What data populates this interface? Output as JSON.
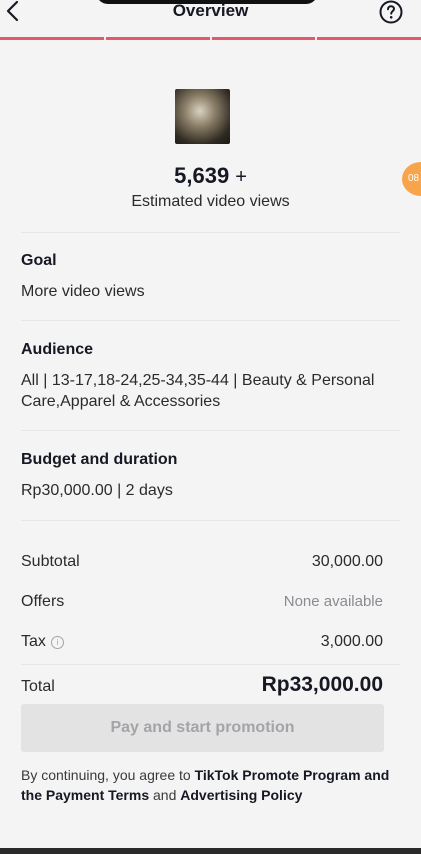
{
  "header": {
    "title": "Overview",
    "back_icon": "chevron-left-icon",
    "help_icon": "question-circle-icon",
    "accent_color": "#e8566b"
  },
  "preview": {
    "views_number": "5,639",
    "views_plus": "+",
    "views_label": "Estimated video views",
    "side_badge": "08"
  },
  "goal": {
    "title": "Goal",
    "value": "More video views"
  },
  "audience": {
    "title": "Audience",
    "value": "All | 13-17,18-24,25-34,35-44 | Beauty & Personal Care,Apparel & Accessories"
  },
  "budget": {
    "title": "Budget and duration",
    "value": "Rp30,000.00 | 2 days"
  },
  "summary": {
    "subtotal_label": "Subtotal",
    "subtotal_value": "30,000.00",
    "offers_label": "Offers",
    "offers_value": "None available",
    "tax_label": "Tax",
    "tax_value": "3,000.00",
    "total_label": "Total",
    "total_value": "Rp33,000.00"
  },
  "pay_button": {
    "label": "Pay and start promotion"
  },
  "terms": {
    "prefix": "By continuing, you agree to",
    "link1": "TikTok Promote Program and the Payment Terms",
    "joiner": "and",
    "link2": "Advertising Policy"
  }
}
